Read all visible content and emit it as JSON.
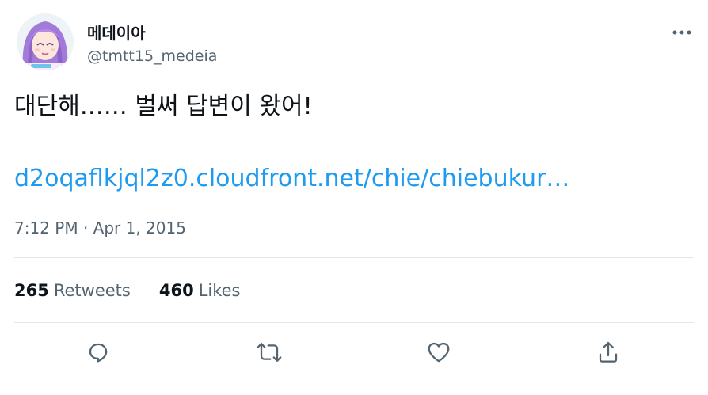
{
  "tweet": {
    "author": {
      "display_name": "메데이아",
      "handle": "@tmtt15_medeia"
    },
    "text": "대단해…… 벌써 답변이 왔어!",
    "link_text": "d2oqaflkjql2z0.cloudfront.net/chie/chiebukur…",
    "timestamp": "7:12 PM · Apr 1, 2015",
    "stats": {
      "retweets_count": "265",
      "retweets_label": "Retweets",
      "likes_count": "460",
      "likes_label": "Likes"
    }
  },
  "icons": {
    "more": "more-horizontal-icon",
    "reply": "reply-icon",
    "retweet": "retweet-icon",
    "like": "heart-icon",
    "share": "share-icon"
  },
  "colors": {
    "link": "#1d9bf0",
    "secondary_text": "#536471",
    "primary_text": "#0f1419",
    "divider": "#e1e8ed",
    "avatar_hair": "#a27ad8"
  }
}
